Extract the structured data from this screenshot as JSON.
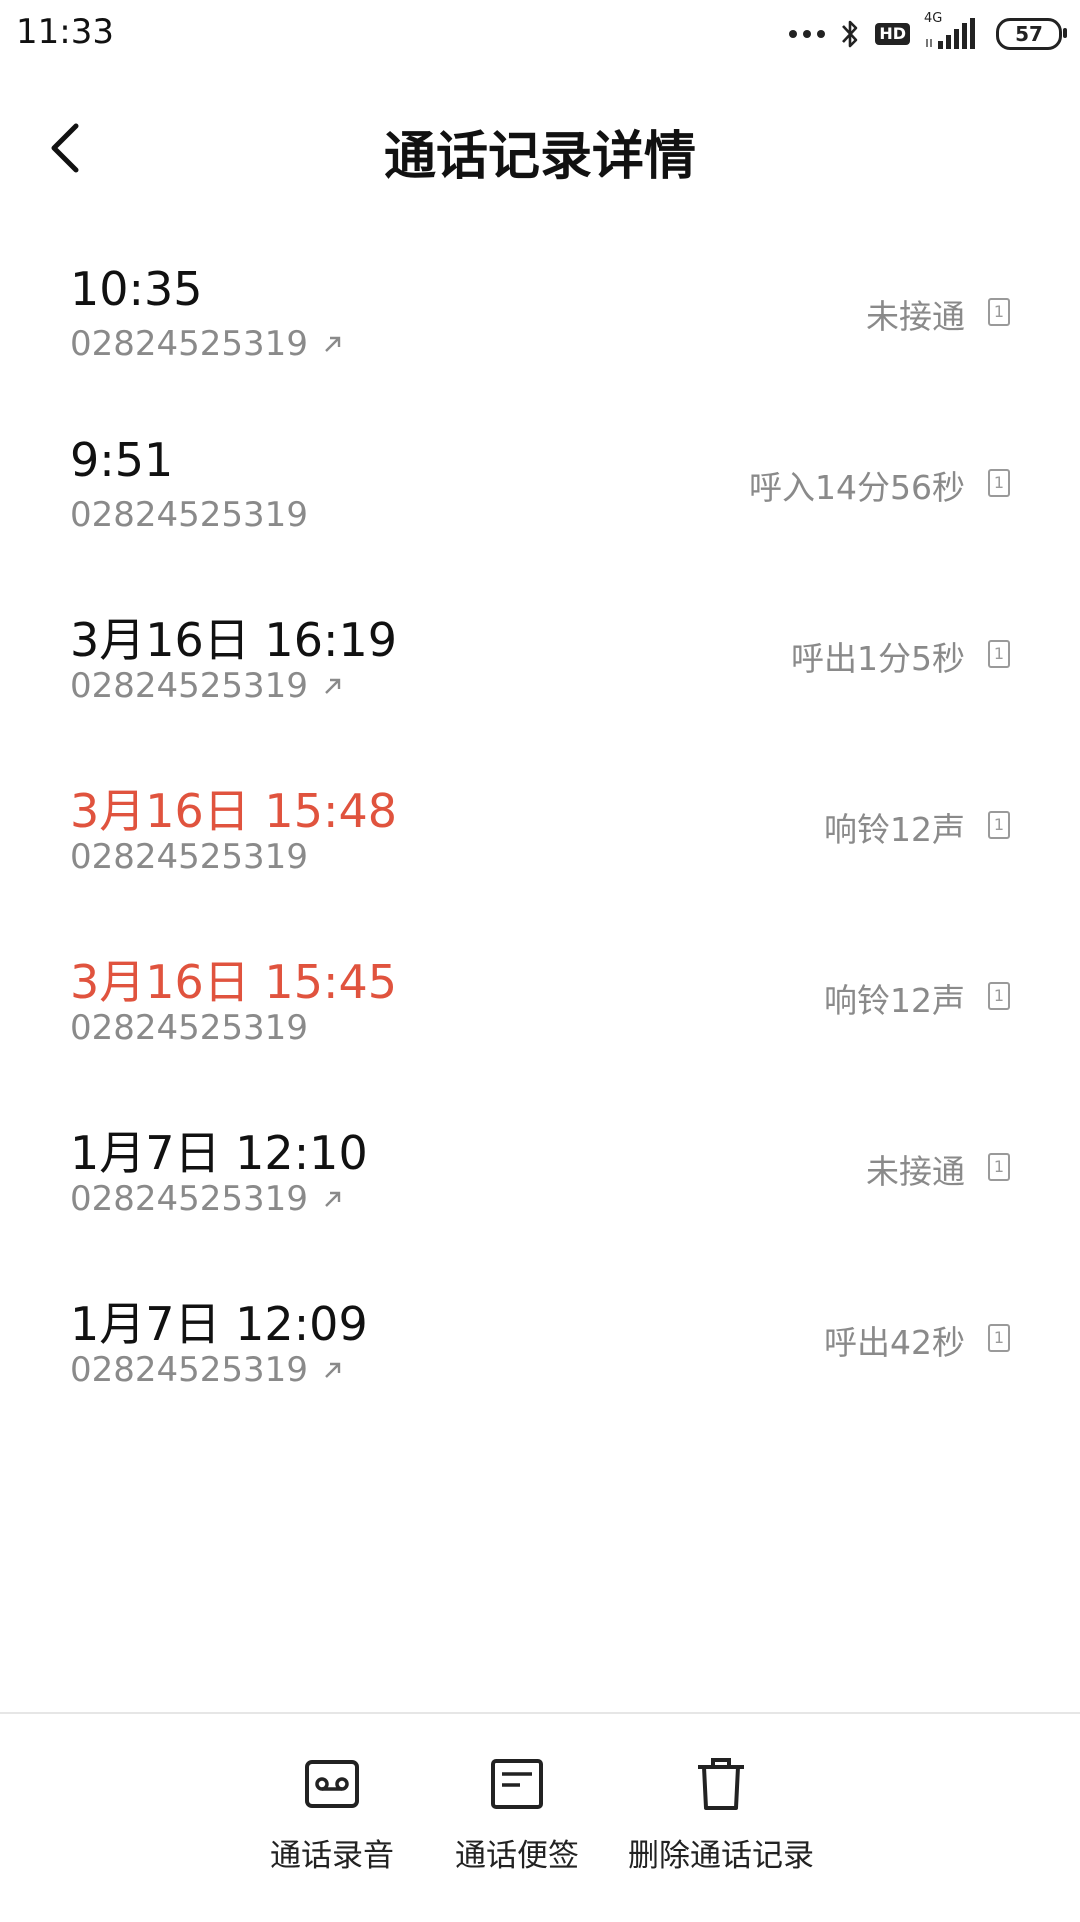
{
  "status_bar": {
    "time": "11:33",
    "network": "4G",
    "hd": "HD",
    "battery": "57",
    "icons": [
      "dots-icon",
      "bluetooth-icon",
      "hd-icon",
      "signal-icon",
      "battery-icon"
    ]
  },
  "header": {
    "title": "通话记录详情",
    "back_icon": "back-chevron-icon"
  },
  "colors": {
    "missed": "#e0533e",
    "primary_text": "#111111",
    "secondary_text": "#8a8a8a"
  },
  "calls": [
    {
      "time": "10:35",
      "number": "02824525319",
      "outgoing": true,
      "status": "未接通",
      "sim": "1",
      "missed": false
    },
    {
      "time": "9:51",
      "number": "02824525319",
      "outgoing": false,
      "status": "呼入14分56秒",
      "sim": "1",
      "missed": false
    },
    {
      "time": "3月16日 16:19",
      "number": "02824525319",
      "outgoing": true,
      "status": "呼出1分5秒",
      "sim": "1",
      "missed": false
    },
    {
      "time": "3月16日 15:48",
      "number": "02824525319",
      "outgoing": false,
      "status": "响铃12声",
      "sim": "1",
      "missed": true
    },
    {
      "time": "3月16日 15:45",
      "number": "02824525319",
      "outgoing": false,
      "status": "响铃12声",
      "sim": "1",
      "missed": true
    },
    {
      "time": "1月7日 12:10",
      "number": "02824525319",
      "outgoing": true,
      "status": "未接通",
      "sim": "1",
      "missed": false
    },
    {
      "time": "1月7日 12:09",
      "number": "02824525319",
      "outgoing": true,
      "status": "呼出42秒",
      "sim": "1",
      "missed": false
    }
  ],
  "bottom_actions": {
    "recording": {
      "label": "通话录音",
      "icon": "recording-icon"
    },
    "notes": {
      "label": "通话便签",
      "icon": "note-icon"
    },
    "delete": {
      "label": "删除通话记录",
      "icon": "trash-icon"
    }
  }
}
